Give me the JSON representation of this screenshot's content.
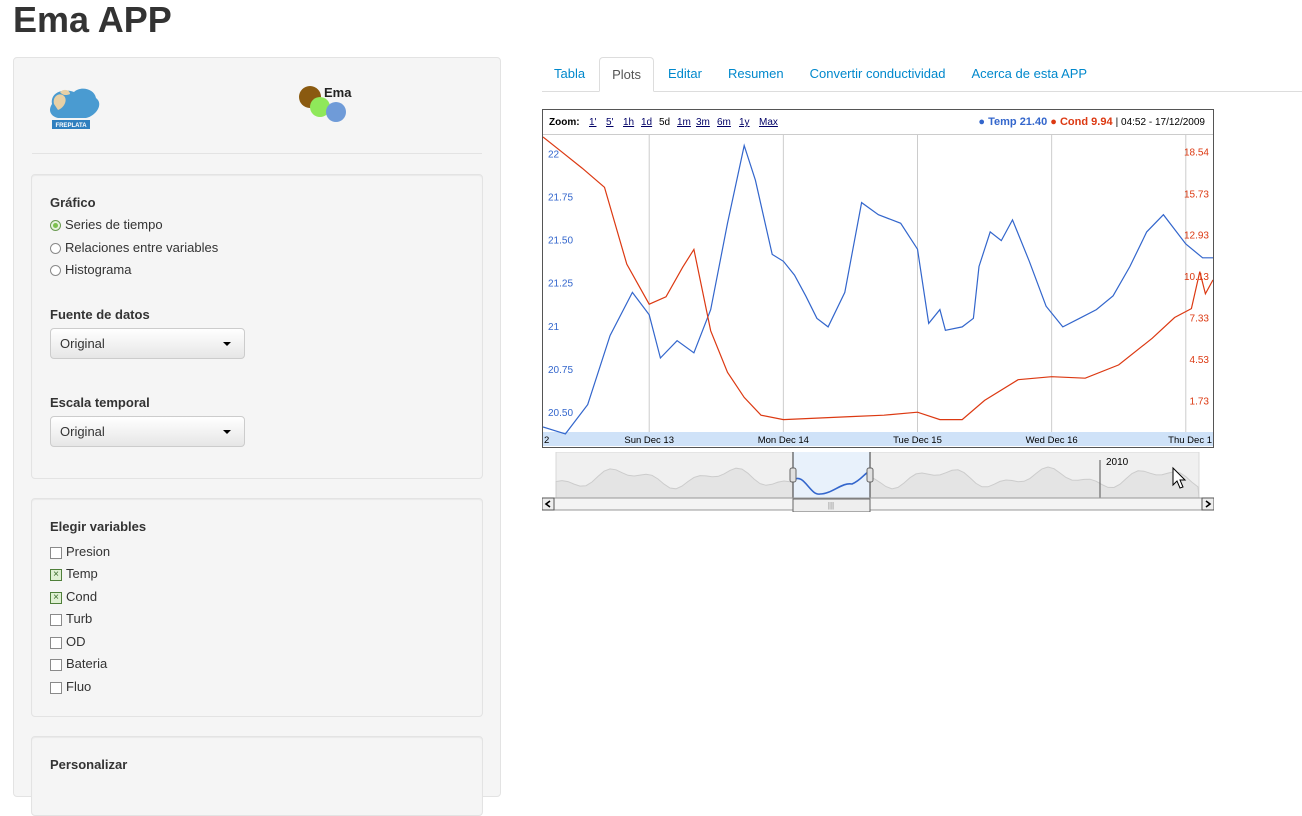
{
  "app": {
    "title": "Ema APP"
  },
  "sidebar": {
    "logo_freplata": "FREPLATA",
    "logo_ema": "Ema",
    "grafico": {
      "label": "Gráfico",
      "options": [
        "Series de tiempo",
        "Relaciones entre variables",
        "Histograma"
      ],
      "selected": 0
    },
    "fuente": {
      "label": "Fuente de datos",
      "value": "Original"
    },
    "escala": {
      "label": "Escala temporal",
      "value": "Original"
    },
    "variables": {
      "label": "Elegir variables",
      "items": [
        {
          "name": "Presion",
          "checked": false
        },
        {
          "name": "Temp",
          "checked": true
        },
        {
          "name": "Cond",
          "checked": true
        },
        {
          "name": "Turb",
          "checked": false
        },
        {
          "name": "OD",
          "checked": false
        },
        {
          "name": "Bateria",
          "checked": false
        },
        {
          "name": "Fluo",
          "checked": false
        }
      ]
    },
    "personalizar": {
      "label": "Personalizar"
    }
  },
  "tabs": [
    "Tabla",
    "Plots",
    "Editar",
    "Resumen",
    "Convertir conductividad",
    "Acerca de esta APP"
  ],
  "active_tab": 1,
  "chart_data": {
    "type": "line",
    "zoom": {
      "label": "Zoom:",
      "options": [
        "1'",
        "5'",
        "1h",
        "1d",
        "5d",
        "1m",
        "3m",
        "6m",
        "1y",
        "Max"
      ],
      "current": "5d"
    },
    "legend": {
      "temp_label": "Temp",
      "temp_value": "21.40",
      "cond_label": "Cond",
      "cond_value": "9.94",
      "timestamp": "04:52 - 17/12/2009"
    },
    "colors": {
      "temp": "#3366cc",
      "cond": "#dc3912"
    },
    "x_ticks": [
      "2",
      "Sun Dec 13",
      "Mon Dec 14",
      "Tue Dec 15",
      "Wed Dec 16",
      "Thu Dec 1"
    ],
    "x_tick_dates": [
      "2009-12-12",
      "2009-12-13",
      "2009-12-14",
      "2009-12-15",
      "2009-12-16",
      "2009-12-17"
    ],
    "xlim": [
      "2009-12-12T05:00",
      "2009-12-17T04:52"
    ],
    "left_axis": {
      "ticks": [
        "22",
        "21.75",
        "21.50",
        "21.25",
        "21",
        "20.75",
        "20.50"
      ],
      "ylim": [
        20.42,
        22.1
      ]
    },
    "right_axis": {
      "ticks": [
        "18.54",
        "15.73",
        "12.93",
        "10.13",
        "7.33",
        "4.53",
        "1.73"
      ],
      "ylim": [
        0.0,
        19.6
      ]
    },
    "series": [
      {
        "name": "Temp",
        "axis": "left",
        "x": [
          "2009-12-12T05:00",
          "2009-12-12T09:00",
          "2009-12-12T13:00",
          "2009-12-12T17:00",
          "2009-12-12T21:00",
          "2009-12-13T00:00",
          "2009-12-13T02:00",
          "2009-12-13T05:00",
          "2009-12-13T08:00",
          "2009-12-13T11:00",
          "2009-12-13T14:00",
          "2009-12-13T17:00",
          "2009-12-13T19:00",
          "2009-12-13T22:00",
          "2009-12-14T00:00",
          "2009-12-14T02:00",
          "2009-12-14T04:00",
          "2009-12-14T06:00",
          "2009-12-14T08:00",
          "2009-12-14T11:00",
          "2009-12-14T14:00",
          "2009-12-14T17:00",
          "2009-12-14T21:00",
          "2009-12-15T00:00",
          "2009-12-15T02:00",
          "2009-12-15T04:00",
          "2009-12-15T05:00",
          "2009-12-15T08:00",
          "2009-12-15T10:00",
          "2009-12-15T11:00",
          "2009-12-15T13:00",
          "2009-12-15T15:00",
          "2009-12-15T17:00",
          "2009-12-15T20:00",
          "2009-12-15T23:00",
          "2009-12-16T02:00",
          "2009-12-16T05:00",
          "2009-12-16T08:00",
          "2009-12-16T11:00",
          "2009-12-16T14:00",
          "2009-12-16T17:00",
          "2009-12-16T20:00",
          "2009-12-17T00:00",
          "2009-12-17T03:00",
          "2009-12-17T04:52"
        ],
        "values": [
          20.42,
          20.38,
          20.55,
          20.95,
          21.2,
          21.07,
          20.82,
          20.92,
          20.85,
          21.1,
          21.6,
          22.05,
          21.85,
          21.42,
          21.38,
          21.3,
          21.18,
          21.05,
          21.0,
          21.2,
          21.72,
          21.65,
          21.6,
          21.45,
          21.02,
          21.1,
          20.98,
          21.0,
          21.05,
          21.35,
          21.55,
          21.5,
          21.62,
          21.38,
          21.12,
          21.0,
          21.05,
          21.1,
          21.18,
          21.35,
          21.55,
          21.65,
          21.48,
          21.4,
          21.4
        ]
      },
      {
        "name": "Cond",
        "axis": "right",
        "x": [
          "2009-12-12T05:00",
          "2009-12-12T08:00",
          "2009-12-12T12:00",
          "2009-12-12T16:00",
          "2009-12-12T20:00",
          "2009-12-13T00:00",
          "2009-12-13T03:00",
          "2009-12-13T06:00",
          "2009-12-13T08:00",
          "2009-12-13T11:00",
          "2009-12-13T14:00",
          "2009-12-13T17:00",
          "2009-12-13T20:00",
          "2009-12-14T00:00",
          "2009-12-14T06:00",
          "2009-12-14T12:00",
          "2009-12-14T18:00",
          "2009-12-15T00:00",
          "2009-12-15T04:00",
          "2009-12-15T08:00",
          "2009-12-15T12:00",
          "2009-12-15T18:00",
          "2009-12-16T00:00",
          "2009-12-16T06:00",
          "2009-12-16T12:00",
          "2009-12-16T18:00",
          "2009-12-16T22:00",
          "2009-12-17T01:00",
          "2009-12-17T02:30",
          "2009-12-17T03:30",
          "2009-12-17T04:52"
        ],
        "values": [
          19.6,
          18.7,
          17.5,
          16.2,
          11.0,
          8.3,
          8.8,
          10.8,
          12.0,
          6.5,
          3.7,
          2.0,
          0.8,
          0.5,
          0.6,
          0.7,
          0.8,
          1.0,
          0.5,
          0.5,
          1.8,
          3.2,
          3.4,
          3.3,
          4.2,
          6.0,
          7.4,
          8.0,
          10.5,
          9.0,
          9.94
        ]
      }
    ],
    "navigator": {
      "label": "2010"
    }
  }
}
